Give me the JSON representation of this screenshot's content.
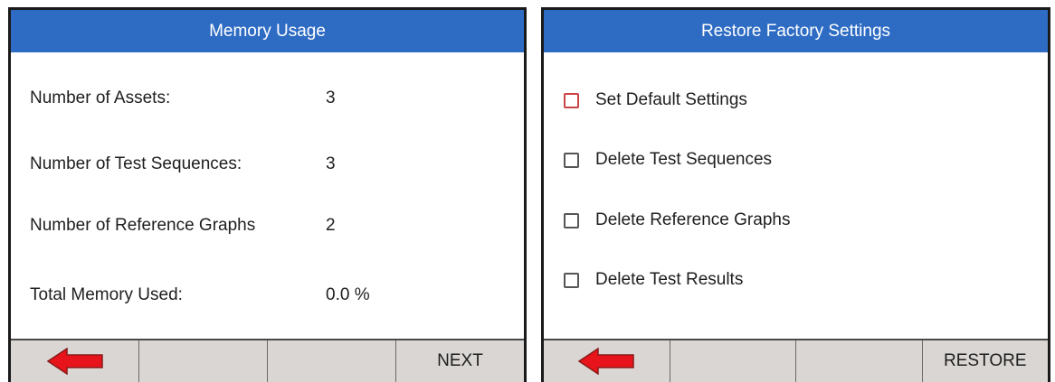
{
  "memory_usage": {
    "title": "Memory Usage",
    "rows": [
      {
        "label": "Number of Assets:",
        "value": "3"
      },
      {
        "label": "Number of Test Sequences:",
        "value": "3"
      },
      {
        "label": "Number of Reference Graphs",
        "value": "2"
      },
      {
        "label": "Total Memory Used:",
        "value": "0.0 %"
      }
    ],
    "softkeys": {
      "back_icon": "red-left-arrow",
      "next_label": "NEXT"
    }
  },
  "restore_factory": {
    "title": "Restore Factory Settings",
    "options": [
      {
        "label": "Set Default Settings",
        "checked": false,
        "focused": true
      },
      {
        "label": "Delete Test Sequences",
        "checked": false,
        "focused": false
      },
      {
        "label": "Delete Reference Graphs",
        "checked": false,
        "focused": false
      },
      {
        "label": "Delete Test Results",
        "checked": false,
        "focused": false
      }
    ],
    "softkeys": {
      "back_icon": "red-left-arrow",
      "restore_label": "RESTORE"
    }
  },
  "colors": {
    "header": "#2e6cc4",
    "softkey_bar": "#d9d6d3",
    "arrow": "#e8141b",
    "focus_border": "#cc4444"
  }
}
